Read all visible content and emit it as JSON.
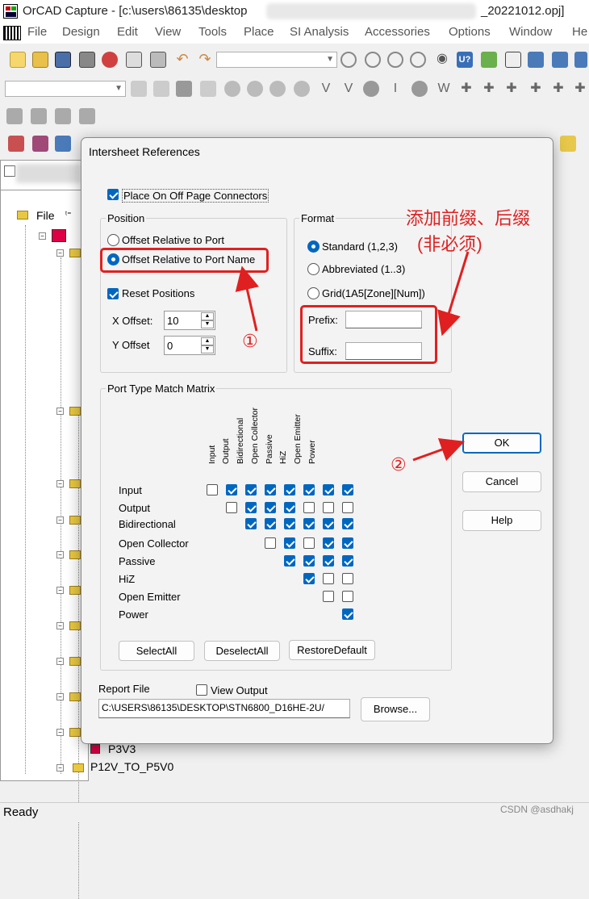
{
  "window": {
    "title_prefix": "OrCAD Capture - [c:\\users\\86135\\desktop",
    "title_suffix": "_20221012.opj]"
  },
  "menu": [
    "File",
    "Design",
    "Edit",
    "View",
    "Tools",
    "Place",
    "SI Analysis",
    "Accessories",
    "Options",
    "Window",
    "He"
  ],
  "tree": {
    "header_label": "File",
    "items": [
      {
        "label": "P3V3"
      },
      {
        "label": "P12V_TO_P5V0"
      }
    ]
  },
  "status": {
    "text": "Ready",
    "watermark": "CSDN @asdhakj"
  },
  "dialog": {
    "title": "Intersheet References",
    "place_connectors": {
      "label": "Place On Off Page Connectors",
      "checked": true
    },
    "position": {
      "group_label": "Position",
      "options": [
        {
          "label": "Offset Relative to Port",
          "selected": false
        },
        {
          "label": "Offset Relative to Port Name",
          "selected": true
        }
      ],
      "reset_positions": {
        "label": "Reset Positions",
        "checked": true
      },
      "x_offset": {
        "label": "X Offset:",
        "value": "10"
      },
      "y_offset": {
        "label": "Y Offset",
        "value": "0"
      }
    },
    "format": {
      "group_label": "Format",
      "options": [
        {
          "label": "Standard (1,2,3)",
          "selected": true
        },
        {
          "label": "Abbreviated (1..3)",
          "selected": false
        },
        {
          "label": "Grid(1A5[Zone][Num])",
          "selected": false
        }
      ],
      "prefix": {
        "label": "Prefix:",
        "value": ""
      },
      "suffix": {
        "label": "Suffix:",
        "value": ""
      }
    },
    "matrix": {
      "group_label": "Port Type Match Matrix",
      "columns": [
        "Input",
        "Output",
        "Bidirectional",
        "Open Collector",
        "Passive",
        "HiZ",
        "Open Emitter",
        "Power"
      ],
      "rows": [
        {
          "label": "Input",
          "cells": [
            false,
            true,
            true,
            true,
            true,
            true,
            true,
            true
          ]
        },
        {
          "label": "Output",
          "cells": [
            false,
            true,
            true,
            true,
            false,
            false,
            false
          ]
        },
        {
          "label": "Bidirectional",
          "cells": [
            true,
            true,
            true,
            true,
            true,
            true
          ]
        },
        {
          "label": "Open Collector",
          "cells": [
            false,
            true,
            false,
            true,
            true
          ]
        },
        {
          "label": "Passive",
          "cells": [
            true,
            true,
            true,
            true
          ]
        },
        {
          "label": "HiZ",
          "cells": [
            true,
            false,
            false
          ]
        },
        {
          "label": "Open Emitter",
          "cells": [
            false,
            false
          ]
        },
        {
          "label": "Power",
          "cells": [
            true
          ]
        }
      ],
      "buttons": {
        "select_all": "SelectAll",
        "deselect_all": "DeselectAll",
        "restore_default": "RestoreDefault"
      }
    },
    "report": {
      "label": "Report File",
      "view_output": {
        "label": "View Output",
        "checked": false
      },
      "path": "C:\\USERS\\86135\\DESKTOP\\STN6800_D16HE-2U/",
      "browse": "Browse..."
    },
    "buttons": {
      "ok": "OK",
      "cancel": "Cancel",
      "help": "Help"
    }
  },
  "annotations": {
    "prefix_suffix_note_line1": "添加前缀、后缀",
    "prefix_suffix_note_line2": "(非必须)",
    "step1": "①",
    "step2": "②",
    "color": "#e02020"
  },
  "colors": {
    "accent": "#0067c0",
    "dialog_bg": "#f3f3f3"
  }
}
